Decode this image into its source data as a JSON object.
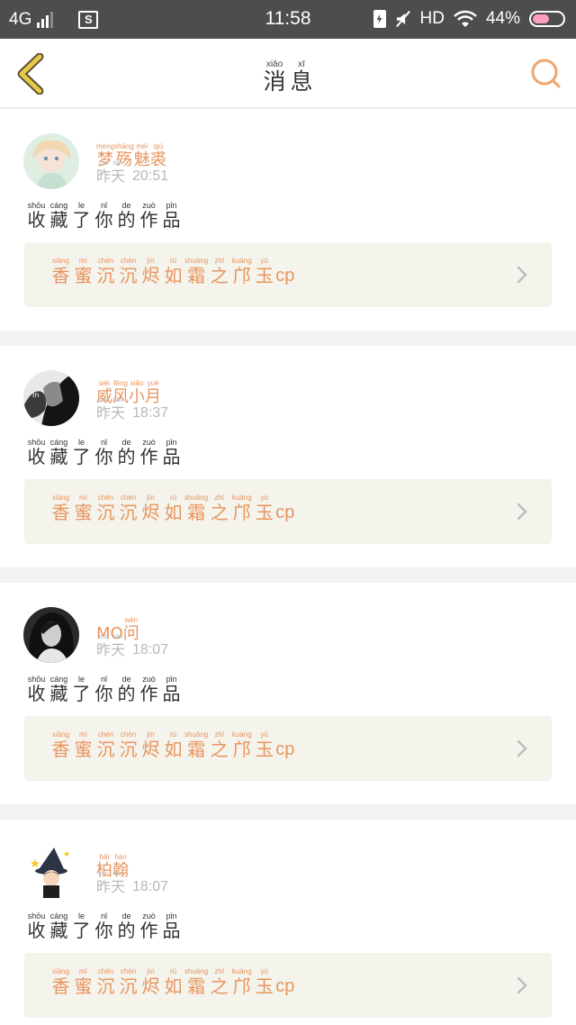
{
  "status_bar": {
    "network": "4G",
    "sim": "S",
    "time": "11:58",
    "hd": "HD",
    "battery": "44%"
  },
  "header": {
    "title": [
      {
        "py": "xiāo",
        "hz": "消"
      },
      {
        "py": "xī",
        "hz": "息"
      }
    ],
    "back_icon": "chevron-left-icon",
    "search_icon": "search-icon"
  },
  "colors": {
    "accent": "#e8955e",
    "back": "#e6c84a",
    "text": "#333333",
    "muted": "#b8b8b8",
    "card_bg": "#f4f3ec"
  },
  "messages": [
    {
      "name": [
        {
          "py": "mèng",
          "hz": "梦"
        },
        {
          "py": "shāng",
          "hz": "殇"
        },
        {
          "py": "mèi",
          "hz": "魅"
        },
        {
          "py": "qiú",
          "hz": "裘"
        }
      ],
      "day": [
        {
          "py": "zuó",
          "hz": "昨"
        },
        {
          "py": "tiān",
          "hz": "天"
        }
      ],
      "time": "20:51",
      "action": [
        {
          "py": "shōu",
          "hz": "收"
        },
        {
          "py": "cáng",
          "hz": "藏"
        },
        {
          "py": "le",
          "hz": "了"
        },
        {
          "py": "nǐ",
          "hz": "你"
        },
        {
          "py": "de",
          "hz": "的"
        },
        {
          "py": "zuò",
          "hz": "作"
        },
        {
          "py": "pǐn",
          "hz": "品"
        }
      ],
      "work": [
        {
          "py": "xiāng",
          "hz": "香"
        },
        {
          "py": "mì",
          "hz": "蜜"
        },
        {
          "py": "chén",
          "hz": "沉"
        },
        {
          "py": "chén",
          "hz": "沉"
        },
        {
          "py": "jìn",
          "hz": "烬"
        },
        {
          "py": "rú",
          "hz": "如"
        },
        {
          "py": "shuāng",
          "hz": "霜"
        },
        {
          "py": "zhī",
          "hz": "之"
        },
        {
          "py": "kuàng",
          "hz": "邝"
        },
        {
          "py": "yù",
          "hz": "玉"
        },
        {
          "py": "",
          "hz": "cp",
          "latin": true
        }
      ]
    },
    {
      "name": [
        {
          "py": "wēi",
          "hz": "威"
        },
        {
          "py": "fēng",
          "hz": "风"
        },
        {
          "py": "xiǎo",
          "hz": "小"
        },
        {
          "py": "yuè",
          "hz": "月"
        }
      ],
      "day": [
        {
          "py": "zuó",
          "hz": "昨"
        },
        {
          "py": "tiān",
          "hz": "天"
        }
      ],
      "time": "18:37",
      "action": [
        {
          "py": "shōu",
          "hz": "收"
        },
        {
          "py": "cáng",
          "hz": "藏"
        },
        {
          "py": "le",
          "hz": "了"
        },
        {
          "py": "nǐ",
          "hz": "你"
        },
        {
          "py": "de",
          "hz": "的"
        },
        {
          "py": "zuò",
          "hz": "作"
        },
        {
          "py": "pǐn",
          "hz": "品"
        }
      ],
      "work": [
        {
          "py": "xiāng",
          "hz": "香"
        },
        {
          "py": "mì",
          "hz": "蜜"
        },
        {
          "py": "chén",
          "hz": "沉"
        },
        {
          "py": "chén",
          "hz": "沉"
        },
        {
          "py": "jìn",
          "hz": "烬"
        },
        {
          "py": "rú",
          "hz": "如"
        },
        {
          "py": "shuāng",
          "hz": "霜"
        },
        {
          "py": "zhī",
          "hz": "之"
        },
        {
          "py": "kuàng",
          "hz": "邝"
        },
        {
          "py": "yù",
          "hz": "玉"
        },
        {
          "py": "",
          "hz": "cp",
          "latin": true
        }
      ]
    },
    {
      "name": [
        {
          "py": "",
          "hz": "MO",
          "latin": true
        },
        {
          "py": "wèn",
          "hz": "问"
        }
      ],
      "day": [
        {
          "py": "zuó",
          "hz": "昨"
        },
        {
          "py": "tiān",
          "hz": "天"
        }
      ],
      "time": "18:07",
      "action": [
        {
          "py": "shōu",
          "hz": "收"
        },
        {
          "py": "cáng",
          "hz": "藏"
        },
        {
          "py": "le",
          "hz": "了"
        },
        {
          "py": "nǐ",
          "hz": "你"
        },
        {
          "py": "de",
          "hz": "的"
        },
        {
          "py": "zuò",
          "hz": "作"
        },
        {
          "py": "pǐn",
          "hz": "品"
        }
      ],
      "work": [
        {
          "py": "xiāng",
          "hz": "香"
        },
        {
          "py": "mì",
          "hz": "蜜"
        },
        {
          "py": "chén",
          "hz": "沉"
        },
        {
          "py": "chén",
          "hz": "沉"
        },
        {
          "py": "jìn",
          "hz": "烬"
        },
        {
          "py": "rú",
          "hz": "如"
        },
        {
          "py": "shuāng",
          "hz": "霜"
        },
        {
          "py": "zhī",
          "hz": "之"
        },
        {
          "py": "kuàng",
          "hz": "邝"
        },
        {
          "py": "yù",
          "hz": "玉"
        },
        {
          "py": "",
          "hz": "cp",
          "latin": true
        }
      ]
    },
    {
      "name": [
        {
          "py": "bǎi",
          "hz": "柏"
        },
        {
          "py": "hàn",
          "hz": "翰"
        }
      ],
      "day": [
        {
          "py": "zuó",
          "hz": "昨"
        },
        {
          "py": "tiān",
          "hz": "天"
        }
      ],
      "time": "18:07",
      "action": [
        {
          "py": "shōu",
          "hz": "收"
        },
        {
          "py": "cáng",
          "hz": "藏"
        },
        {
          "py": "le",
          "hz": "了"
        },
        {
          "py": "nǐ",
          "hz": "你"
        },
        {
          "py": "de",
          "hz": "的"
        },
        {
          "py": "zuò",
          "hz": "作"
        },
        {
          "py": "pǐn",
          "hz": "品"
        }
      ],
      "work": [
        {
          "py": "xiāng",
          "hz": "香"
        },
        {
          "py": "mì",
          "hz": "蜜"
        },
        {
          "py": "chén",
          "hz": "沉"
        },
        {
          "py": "chén",
          "hz": "沉"
        },
        {
          "py": "jìn",
          "hz": "烬"
        },
        {
          "py": "rú",
          "hz": "如"
        },
        {
          "py": "shuāng",
          "hz": "霜"
        },
        {
          "py": "zhī",
          "hz": "之"
        },
        {
          "py": "kuàng",
          "hz": "邝"
        },
        {
          "py": "yù",
          "hz": "玉"
        },
        {
          "py": "",
          "hz": "cp",
          "latin": true
        }
      ]
    }
  ]
}
